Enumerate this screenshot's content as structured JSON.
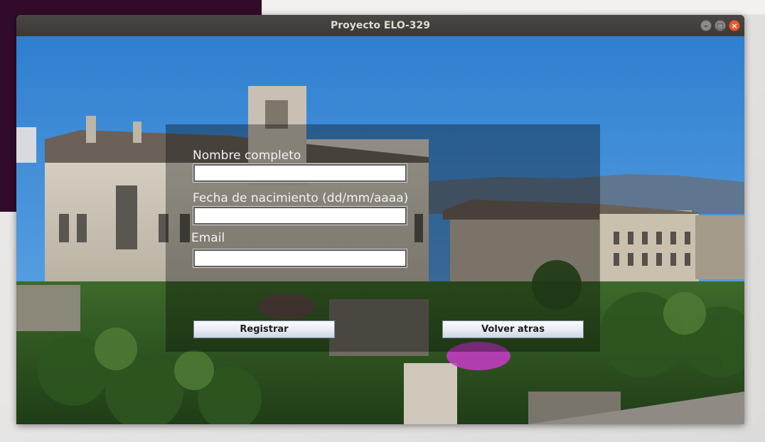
{
  "window": {
    "title": "Proyecto ELO-329"
  },
  "form": {
    "name_label": "Nombre completo",
    "birth_label": "Fecha de nacimiento (dd/mm/aaaa)",
    "email_label": "Email",
    "name_value": "",
    "birth_value": "",
    "email_value": "",
    "register_button": "Registrar",
    "back_button": "Volver atras"
  },
  "colors": {
    "titlebar": "#3f3d3a",
    "close_button": "#e95b31",
    "desktop_purple": "#320b2a",
    "button_text": "#1c1c1c"
  }
}
